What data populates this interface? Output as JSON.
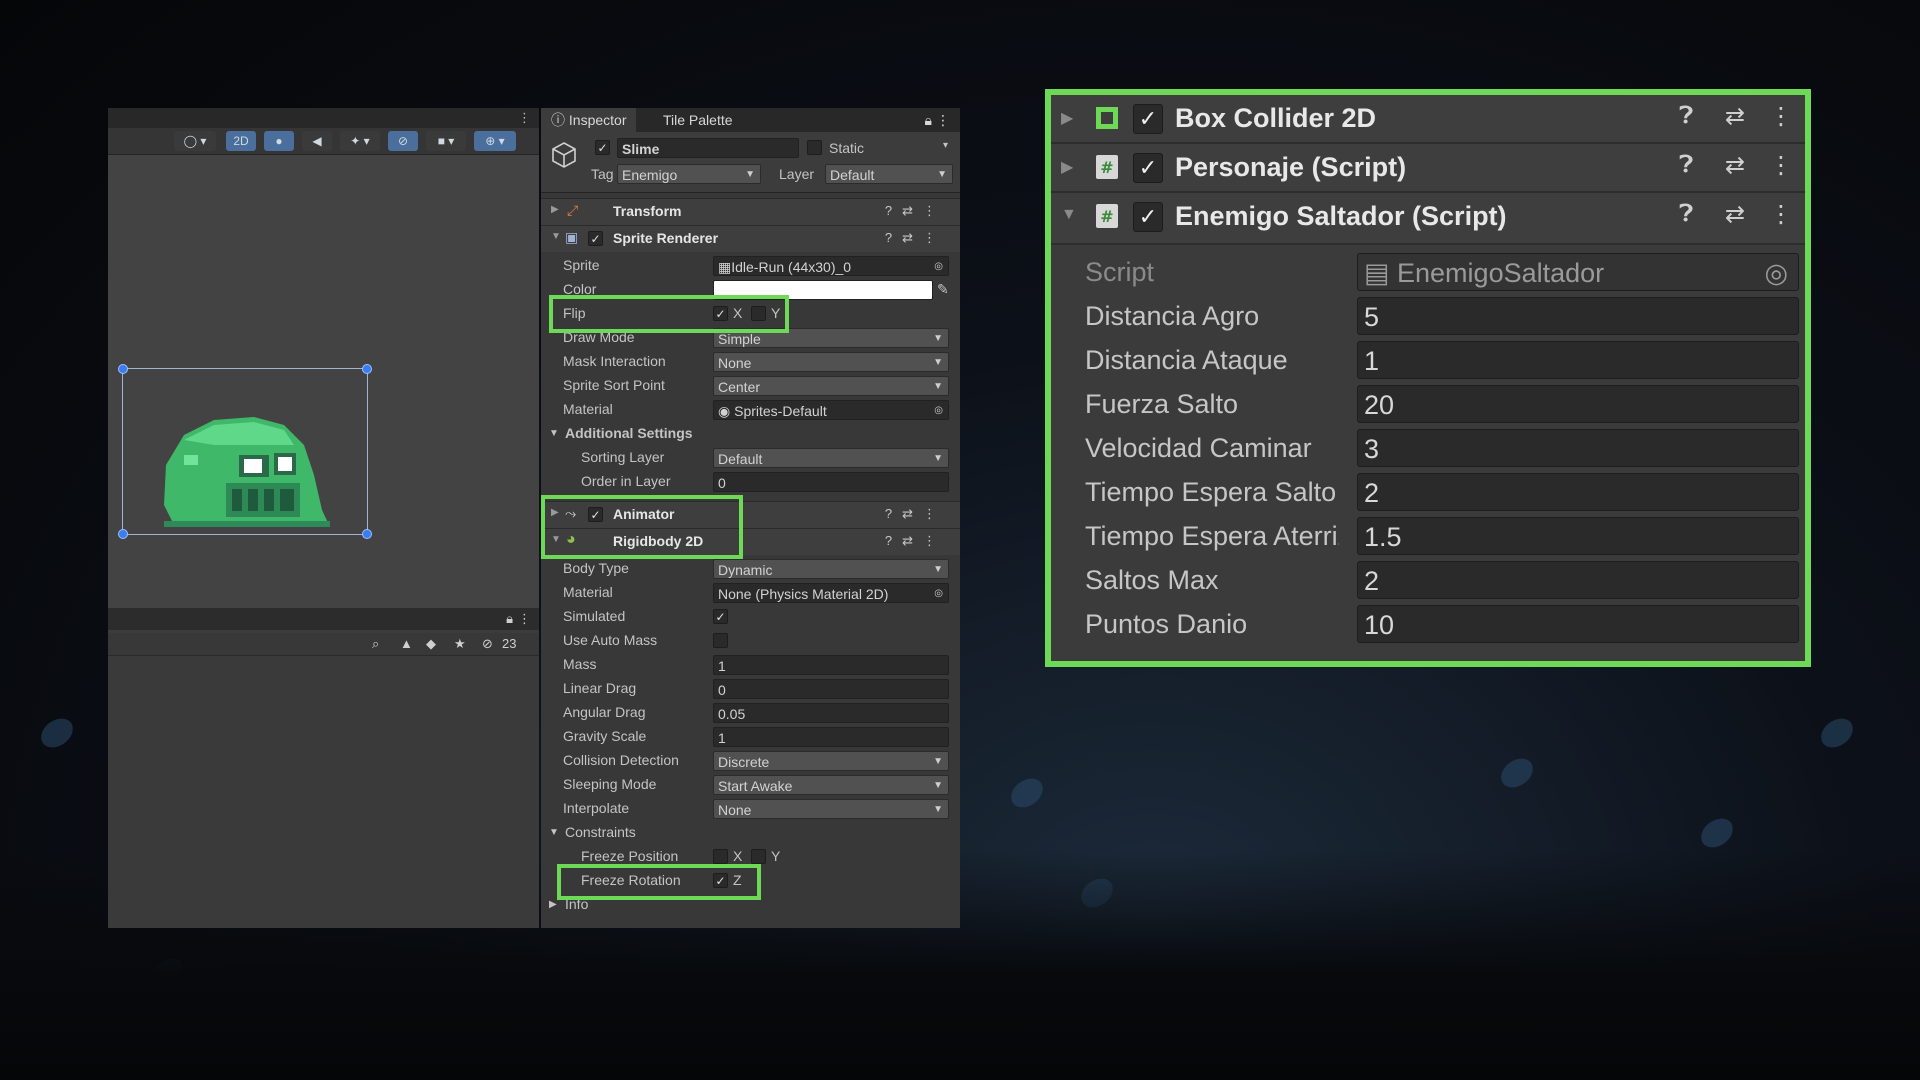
{
  "scene": {
    "toolbar": {
      "mode_2d": "2D",
      "hidden_count": "23"
    }
  },
  "inspector": {
    "tabs": [
      "Inspector",
      "Tile Palette"
    ],
    "gameobject": {
      "name": "Slime",
      "static_label": "Static",
      "tag_label": "Tag",
      "tag_value": "Enemigo",
      "layer_label": "Layer",
      "layer_value": "Default"
    },
    "transform": {
      "title": "Transform"
    },
    "sprite_renderer": {
      "title": "Sprite Renderer",
      "sprite_label": "Sprite",
      "sprite_value": "Idle-Run (44x30)_0",
      "color_label": "Color",
      "flip_label": "Flip",
      "flip_x": "X",
      "flip_y": "Y",
      "draw_mode_label": "Draw Mode",
      "draw_mode_value": "Simple",
      "mask_label": "Mask Interaction",
      "mask_value": "None",
      "sort_point_label": "Sprite Sort Point",
      "sort_point_value": "Center",
      "material_label": "Material",
      "material_value": "Sprites-Default",
      "additional_label": "Additional Settings",
      "sorting_layer_label": "Sorting Layer",
      "sorting_layer_value": "Default",
      "order_label": "Order in Layer",
      "order_value": "0"
    },
    "animator": {
      "title": "Animator"
    },
    "rigidbody": {
      "title": "Rigidbody 2D",
      "body_type_label": "Body Type",
      "body_type_value": "Dynamic",
      "material_label": "Material",
      "material_value": "None (Physics Material 2D)",
      "simulated_label": "Simulated",
      "auto_mass_label": "Use Auto Mass",
      "mass_label": "Mass",
      "mass_value": "1",
      "linear_drag_label": "Linear Drag",
      "linear_drag_value": "0",
      "angular_drag_label": "Angular Drag",
      "angular_drag_value": "0.05",
      "gravity_label": "Gravity Scale",
      "gravity_value": "1",
      "collision_label": "Collision Detection",
      "collision_value": "Discrete",
      "sleeping_label": "Sleeping Mode",
      "sleeping_value": "Start Awake",
      "interpolate_label": "Interpolate",
      "interpolate_value": "None",
      "constraints_label": "Constraints",
      "freeze_pos_label": "Freeze Position",
      "freeze_pos_x": "X",
      "freeze_pos_y": "Y",
      "freeze_rot_label": "Freeze Rotation",
      "freeze_rot_z": "Z",
      "info_label": "Info"
    }
  },
  "zoom_panel": {
    "components": [
      "Box Collider 2D",
      "Personaje (Script)",
      "Enemigo Saltador (Script)"
    ],
    "script_label": "Script",
    "script_value": "EnemigoSaltador",
    "fields": [
      {
        "label": "Distancia Agro",
        "value": "5"
      },
      {
        "label": "Distancia Ataque",
        "value": "1"
      },
      {
        "label": "Fuerza Salto",
        "value": "20"
      },
      {
        "label": "Velocidad Caminar",
        "value": "3"
      },
      {
        "label": "Tiempo Espera Salto",
        "value": "2"
      },
      {
        "label": "Tiempo Espera Aterriz",
        "value": "1.5"
      },
      {
        "label": "Saltos Max",
        "value": "2"
      },
      {
        "label": "Puntos Danio",
        "value": "10"
      }
    ]
  },
  "colors": {
    "highlight": "#6ed957",
    "accent": "#4a6f9c",
    "panel": "#383838"
  }
}
